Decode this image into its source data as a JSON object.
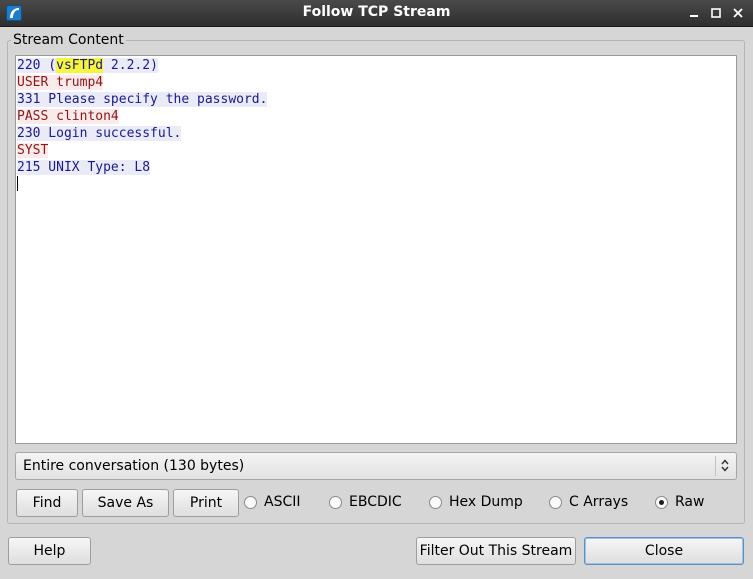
{
  "window": {
    "title": "Follow TCP Stream",
    "app_icon": "wireshark-fin-icon",
    "controls": [
      "minimize-icon",
      "maximize-icon",
      "close-icon"
    ]
  },
  "stream_group": {
    "label": "Stream Content"
  },
  "stream_lines": [
    {
      "direction": "server",
      "text_before": "220 (",
      "highlight": "vsFTPd",
      "text_after": " 2.2.2)"
    },
    {
      "direction": "client",
      "text": "USER trump4"
    },
    {
      "direction": "server",
      "text": "331 Please specify the password."
    },
    {
      "direction": "client",
      "text": "PASS clinton4"
    },
    {
      "direction": "server",
      "text": "230 Login successful."
    },
    {
      "direction": "client",
      "text": "SYST"
    },
    {
      "direction": "server",
      "text": "215 UNIX Type: L8"
    }
  ],
  "conversation_select": {
    "value": "Entire conversation (130 bytes)"
  },
  "actions": {
    "find": "Find",
    "save_as": "Save As",
    "print": "Print"
  },
  "format_options": [
    {
      "label": "ASCII",
      "selected": false
    },
    {
      "label": "EBCDIC",
      "selected": false
    },
    {
      "label": "Hex Dump",
      "selected": false
    },
    {
      "label": "C Arrays",
      "selected": false
    },
    {
      "label": "Raw",
      "selected": true
    }
  ],
  "footer": {
    "help": "Help",
    "filter_out": "Filter Out This Stream",
    "close": "Close"
  },
  "colors": {
    "server_text": "#1a1a8c",
    "server_bg": "#ebebf7",
    "client_text": "#8f1515",
    "client_bg": "#f9ebeb",
    "highlight": "#f7f73a"
  }
}
